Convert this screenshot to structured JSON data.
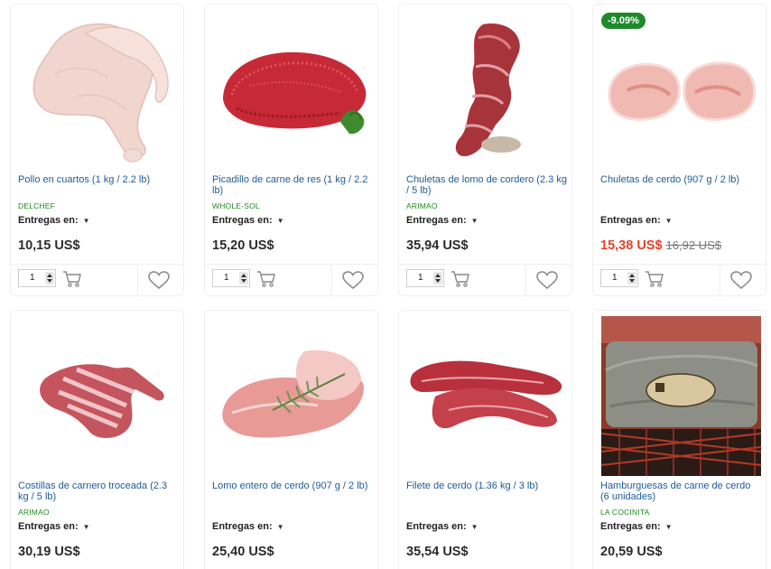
{
  "currency": "US$",
  "delivery_label": "Entregas en:",
  "products": [
    {
      "title": "Pollo en cuartos (1 kg / 2.2 lb)",
      "brand": "DELCHEF",
      "price": "10,15 US$",
      "qty": "1",
      "image": "chicken-quarters"
    },
    {
      "title": "Picadillo de carne de res (1 kg / 2.2 lb)",
      "brand": "WHOLE-SOL",
      "price": "15,20 US$",
      "qty": "1",
      "image": "ground-beef"
    },
    {
      "title": "Chuletas de lomo de cordero (2.3 kg / 5 lb)",
      "brand": "ARIMAO",
      "price": "35,94 US$",
      "qty": "1",
      "image": "lamb-chops"
    },
    {
      "title": "Chuletas de cerdo (907 g / 2 lb)",
      "brand": "",
      "badge": "-9.09%",
      "price": "15,38 US$",
      "old_price": "16,92 US$",
      "qty": "1",
      "image": "pork-chops"
    },
    {
      "title": "Costillas de carnero troceada (2.3 kg / 5 lb)",
      "brand": "ARIMAO",
      "price": "30,19 US$",
      "image": "lamb-ribs"
    },
    {
      "title": "Lomo entero de cerdo (907 g / 2 lb)",
      "brand": "",
      "price": "25,40 US$",
      "image": "pork-loin"
    },
    {
      "title": "Filete de cerdo (1.36 kg / 3 lb)",
      "brand": "",
      "price": "35,54 US$",
      "image": "pork-tenderloin"
    },
    {
      "title": "Hamburguesas de carne de cerdo (6 unidades)",
      "brand": "LA COCINITA",
      "price": "20,59 US$",
      "image": "pork-burgers-package"
    }
  ],
  "colors": {
    "title_link": "#1d5a9c",
    "brand": "#1e8a1e",
    "sale_price": "#e8412a",
    "badge_bg": "#1f8a2b"
  }
}
